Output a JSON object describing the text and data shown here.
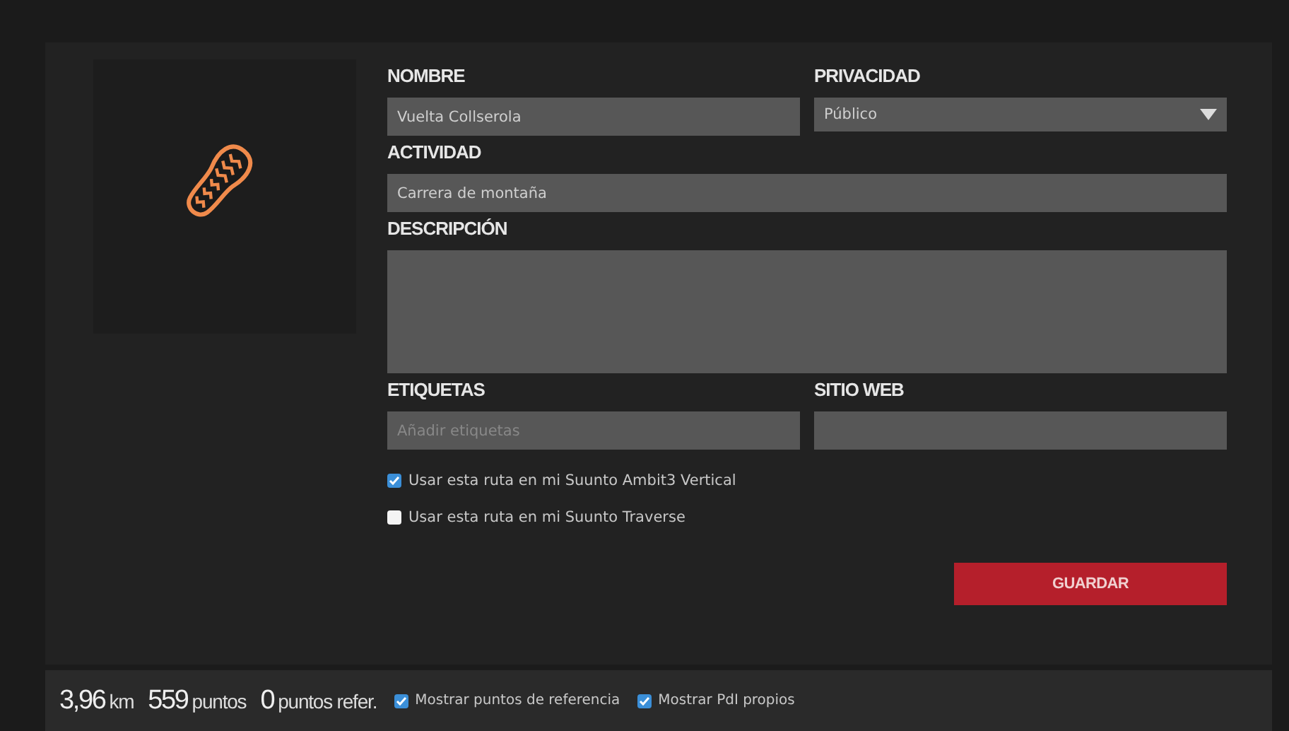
{
  "form": {
    "name": {
      "label": "NOMBRE",
      "value": "Vuelta Collserola"
    },
    "privacy": {
      "label": "PRIVACIDAD",
      "value": "Público"
    },
    "activity": {
      "label": "ACTIVIDAD",
      "value": "Carrera de montaña"
    },
    "description": {
      "label": "DESCRIPCIÓN"
    },
    "tags": {
      "label": "ETIQUETAS",
      "placeholder": "Añadir etiquetas"
    },
    "website": {
      "label": "SITIO WEB"
    },
    "options": [
      {
        "label": "Usar esta ruta en mi Suunto Ambit3 Vertical",
        "checked": true
      },
      {
        "label": "Usar esta ruta en mi Suunto Traverse",
        "checked": false
      }
    ],
    "save_button": "GUARDAR"
  },
  "status_bar": {
    "stats": [
      {
        "value": "3,96",
        "unit": "km"
      },
      {
        "value": "559",
        "unit": "puntos"
      },
      {
        "value": "0",
        "unit": "puntos refer."
      }
    ],
    "toggles": [
      {
        "label": "Mostrar puntos de referencia",
        "checked": true
      },
      {
        "label": "Mostrar PdI propios",
        "checked": true
      }
    ]
  }
}
